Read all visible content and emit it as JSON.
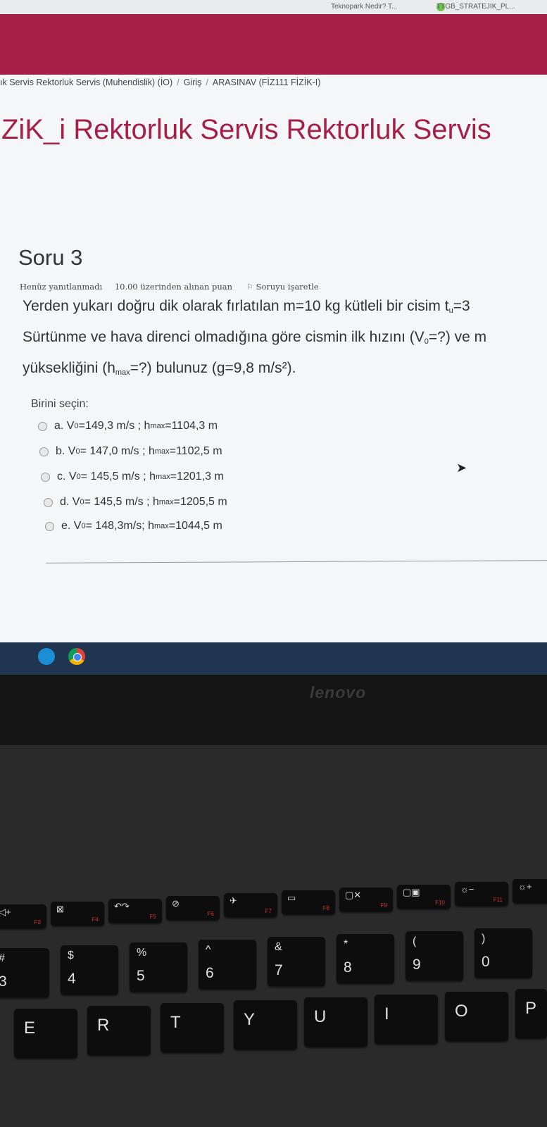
{
  "browser": {
    "tabs": [
      "Teknopark Nedir? T...",
      "TTGB_STRATEJIK_PL..."
    ]
  },
  "breadcrumb": {
    "items": [
      "ık Servis Rektorluk Servis (Muhendislik) (İO)",
      "Giriş",
      "ARASINAV (FİZ111 FİZİK-I)"
    ],
    "separator": "/"
  },
  "course_title": "ZiK_i Rektorluk Servis Rektorluk Servis",
  "question": {
    "title": "Soru 3",
    "status": "Henüz yanıtlanmadı",
    "points": "10.00 üzerinden alınan puan",
    "flag_label": "Soruyu işaretle",
    "text_line1": "Yerden yukarı doğru dik olarak fırlatılan m=10 kg kütleli bir cisim t",
    "text_line1_sub": "u",
    "text_line1_end": "=3",
    "text_line2_a": "Sürtünme ve hava direnci olmadığına göre cismin ilk hızını (V",
    "text_line2_sub": "0",
    "text_line2_b": "=?) ve m",
    "text_line3_a": "yüksekliğini (h",
    "text_line3_sub": "max",
    "text_line3_b": "=?) bulunuz (g=9,8 m/s²).",
    "choose_label": "Birini seçin:",
    "options": [
      {
        "prefix": "a. V",
        "v_sub": "0",
        "v_val": "=149,3 m/s ; h",
        "h_sub": "max",
        "h_val": "=1104,3 m"
      },
      {
        "prefix": "b. V",
        "v_sub": "0",
        "v_val": "= 147,0 m/s ; h",
        "h_sub": "max",
        "h_val": "=1102,5 m"
      },
      {
        "prefix": "c. V",
        "v_sub": "0",
        "v_val": "= 145,5 m/s ; h",
        "h_sub": "max",
        "h_val": "=1201,3 m"
      },
      {
        "prefix": "d. V",
        "v_sub": "0",
        "v_val": "= 145,5 m/s ; h",
        "h_sub": "max",
        "h_val": "=1205,5 m"
      },
      {
        "prefix": "e. V",
        "v_sub": "0",
        "v_val": "= 148,3m/s; h",
        "h_sub": "max",
        "h_val": "=1044,5 m"
      }
    ]
  },
  "taskbar": {
    "icons": [
      "edge-icon",
      "chrome-icon"
    ]
  },
  "laptop": {
    "brand": "lenovo",
    "fkeys": [
      "F3",
      "F4",
      "F5",
      "F6",
      "F7",
      "F8",
      "F9",
      "F10",
      "F11"
    ],
    "number_keys": [
      {
        "top": "#",
        "bot": "3"
      },
      {
        "top": "$",
        "bot": "4"
      },
      {
        "top": "%",
        "bot": "5"
      },
      {
        "top": "^",
        "bot": "6"
      },
      {
        "top": "&",
        "bot": "7"
      },
      {
        "top": "*",
        "bot": "8"
      },
      {
        "top": "(",
        "bot": "9"
      },
      {
        "top": ")",
        "bot": "0"
      }
    ],
    "letter_keys": [
      "E",
      "R",
      "T",
      "Y",
      "U",
      "I",
      "O",
      "P"
    ]
  },
  "colors": {
    "brand": "#a51f46",
    "taskbar": "#1f3550"
  }
}
